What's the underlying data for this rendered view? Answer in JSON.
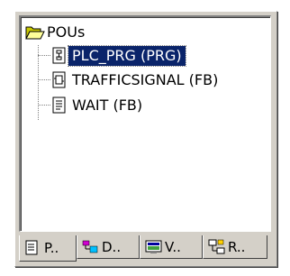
{
  "tree": {
    "root": {
      "label": "POUs",
      "icon": "folder-open-icon"
    },
    "children": [
      {
        "label": "PLC_PRG (PRG)",
        "icon": "program-icon",
        "selected": true
      },
      {
        "label": "TRAFFICSIGNAL (FB)",
        "icon": "function-block-icon",
        "selected": false
      },
      {
        "label": "WAIT (FB)",
        "icon": "function-block-doc-icon",
        "selected": false
      }
    ]
  },
  "tabs": [
    {
      "label": "P..",
      "icon": "pou-tab-icon",
      "active": true
    },
    {
      "label": "D..",
      "icon": "datatypes-tab-icon",
      "active": false
    },
    {
      "label": "V..",
      "icon": "visualization-tab-icon",
      "active": false
    },
    {
      "label": "R..",
      "icon": "resources-tab-icon",
      "active": false
    }
  ],
  "colors": {
    "selection": "#0a246a",
    "panel": "#d4d0c8"
  }
}
